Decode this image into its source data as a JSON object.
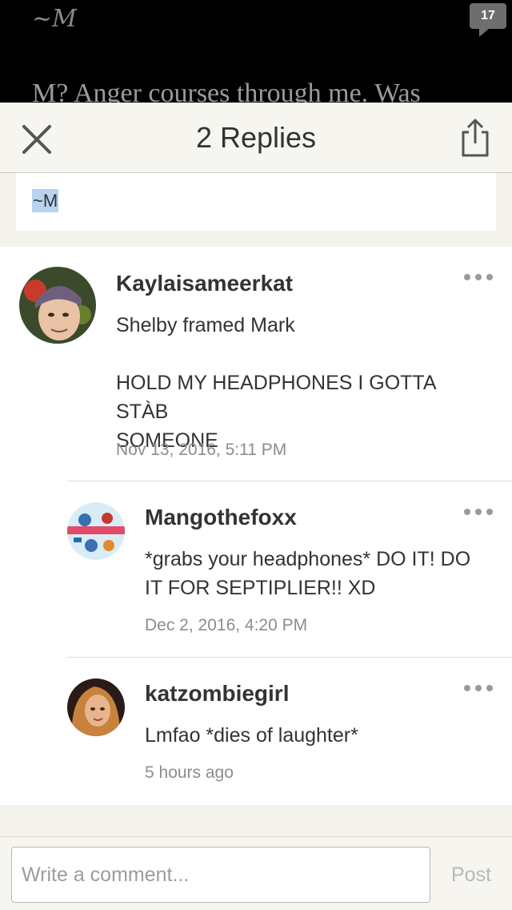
{
  "story": {
    "title": "~M",
    "text": "M? Anger courses through me. Was",
    "comment_count": "17"
  },
  "sheet": {
    "title": "2 Replies",
    "quoted_text": "~M"
  },
  "comments": [
    {
      "username": "Kaylaisameerkat",
      "body": "Shelby framed Mark\n\nHOLD MY HEADPHONES I GOTTA STÀB\nSOMEONE",
      "timestamp": "Nov 13, 2016, 5:11 PM"
    },
    {
      "username": "Mangothefoxx",
      "body": "*grabs your headphones* DO IT! DO\nIT FOR SEPTIPLIER!! XD",
      "timestamp": "Dec 2, 2016, 4:20 PM"
    },
    {
      "username": "katzombiegirl",
      "body": "Lmfao *dies of laughter*",
      "timestamp": "5 hours ago"
    }
  ],
  "composer": {
    "placeholder": "Write a comment...",
    "post_label": "Post"
  },
  "colors": {
    "sheet_bg": "#f3f2ec",
    "quote_highlight": "#b7d3f0",
    "muted_text": "#8c8c8c"
  }
}
